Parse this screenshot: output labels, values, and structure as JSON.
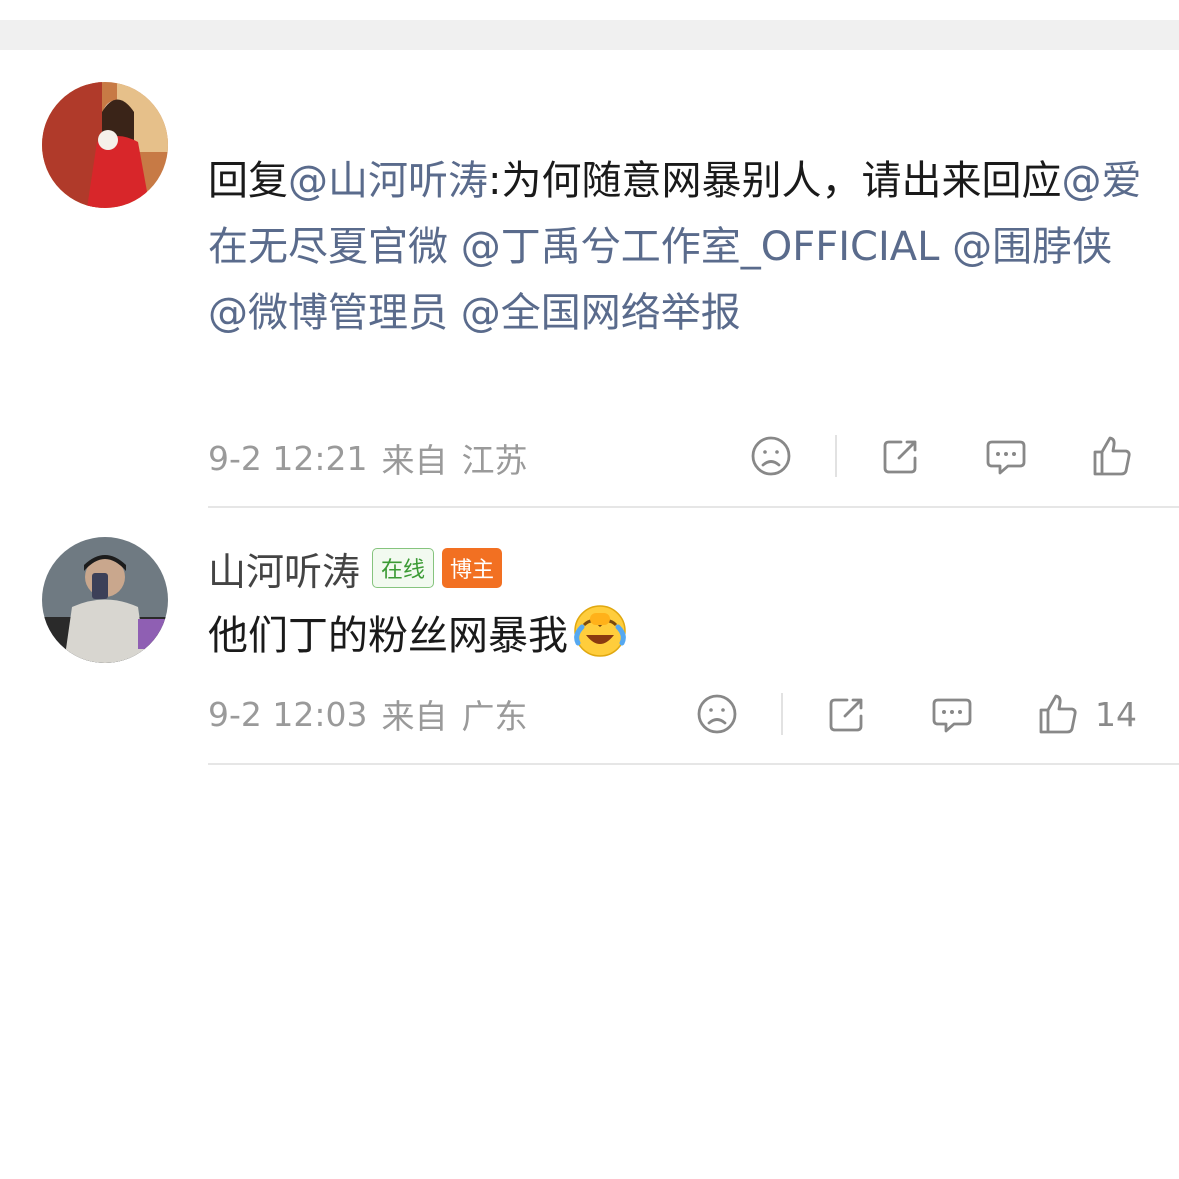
{
  "comments": [
    {
      "username": "",
      "text_parts": [
        {
          "text": "回复",
          "mention": false
        },
        {
          "text": "@山河听涛",
          "mention": true
        },
        {
          "text": ":为何随意网暴别人，请出来回应",
          "mention": false
        },
        {
          "text": "@爱在无尽夏官微",
          "mention": true
        },
        {
          "text": " ",
          "mention": false
        },
        {
          "text": "@丁禹兮工作室_OFFICIAL",
          "mention": true
        },
        {
          "text": " ",
          "mention": false
        },
        {
          "text": "@围脖侠",
          "mention": true
        },
        {
          "text": " ",
          "mention": false
        },
        {
          "text": "@微博管理员",
          "mention": true
        },
        {
          "text": " ",
          "mention": false
        },
        {
          "text": "@全国网络举报",
          "mention": true
        }
      ],
      "date": "9-2 12:21",
      "from_label": "来自",
      "location": "江苏",
      "like_count": ""
    },
    {
      "username": "山河听涛",
      "badges": [
        "在线",
        "博主"
      ],
      "text": "他们丁的粉丝网暴我",
      "emoji": "crying-laughing-emoji",
      "date": "9-2 12:03",
      "from_label": "来自",
      "location": "广东",
      "like_count": "14"
    }
  ],
  "icons": [
    "dislike-face-icon",
    "share-icon",
    "comment-icon",
    "like-thumb-icon"
  ],
  "colors": {
    "mention": "#5a6b8c",
    "meta": "#9a9a9a",
    "online_badge": "#3b9a34",
    "blogger_badge": "#f27022"
  }
}
